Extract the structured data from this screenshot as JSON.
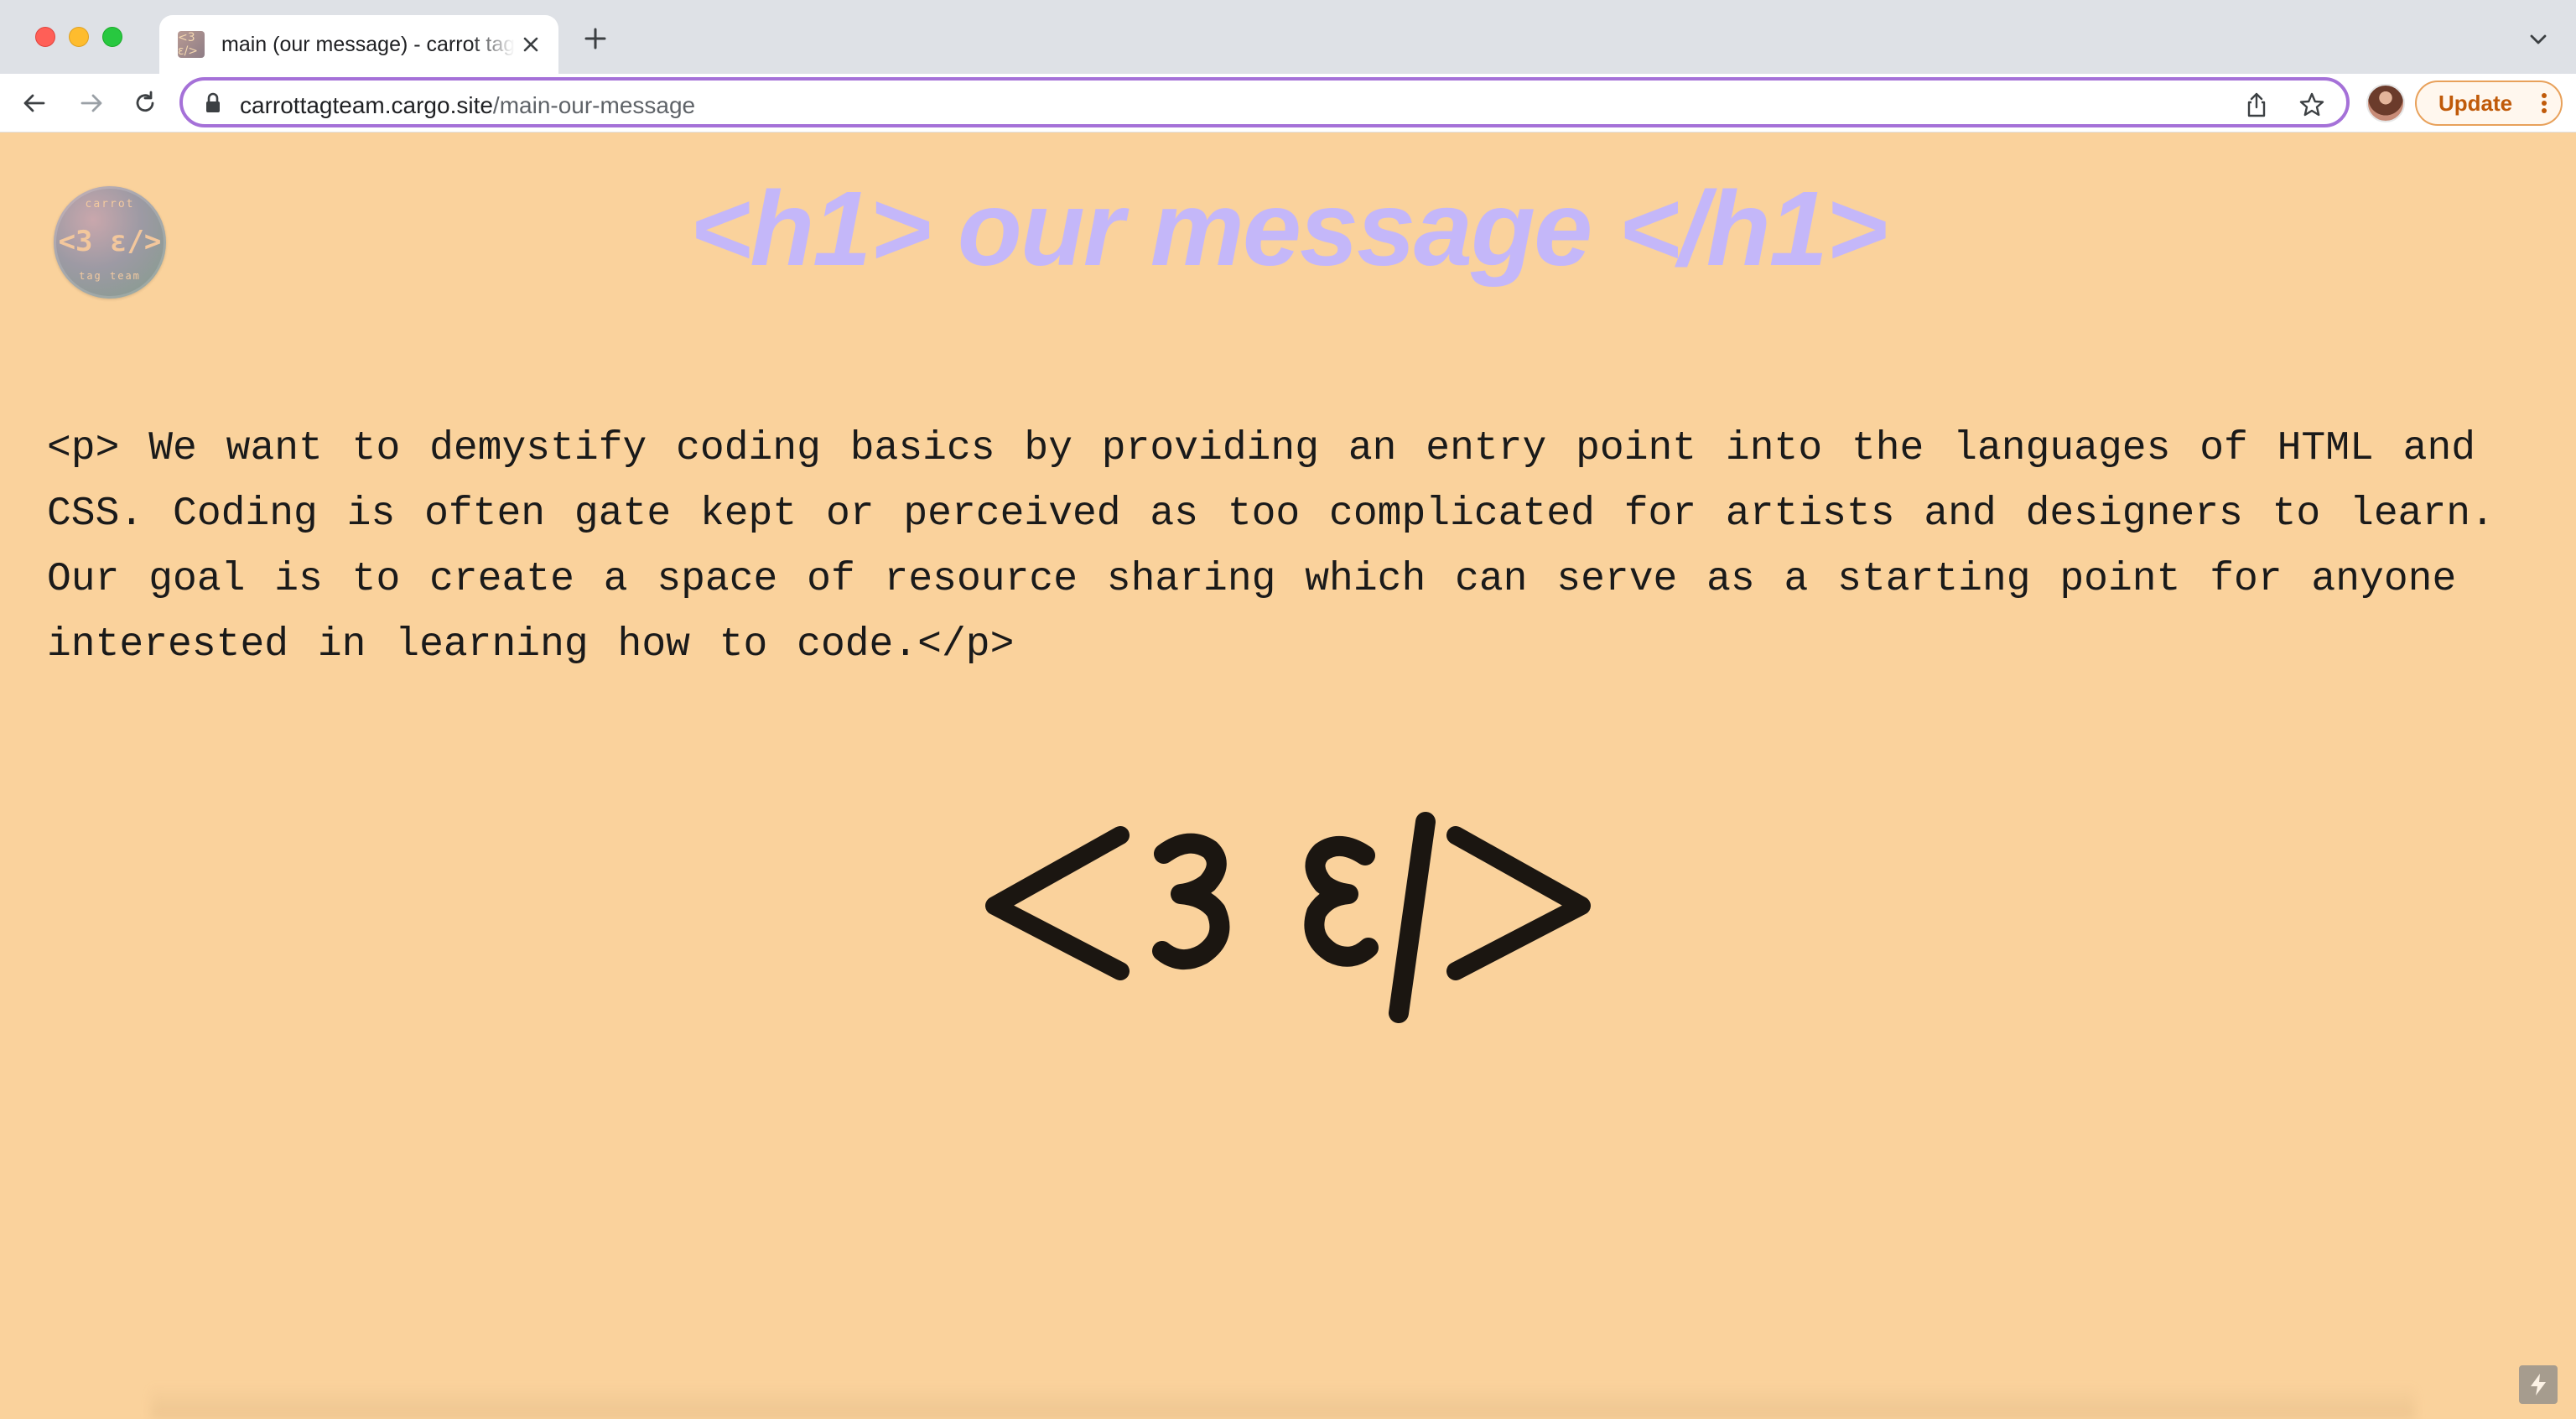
{
  "browser": {
    "tab": {
      "title": "main (our message) - carrot tag team",
      "favicon_text": "<3 ε/>"
    },
    "address_bar": {
      "domain": "carrottagteam.cargo.site",
      "path": "/main-our-message"
    },
    "update_button": {
      "label": "Update"
    },
    "colors": {
      "omnibox_focus": "#a571d8",
      "update_text": "#c05a09"
    }
  },
  "page": {
    "background": "#fad29c",
    "badge": {
      "top_text": "carrot",
      "mid_text": "<3 ε/>",
      "bottom_text": "tag team"
    },
    "heading": "<h1> our message </h1>",
    "heading_color": "#c4b7f9",
    "message": "<p> We want to demystify coding basics by providing an entry point into the languages of HTML and CSS. Coding is often gate kept or perceived as too complicated for artists and designers to learn. Our goal is to create a space of resource sharing which can serve as a starting point for anyone interested in learning how to code.</p>",
    "logo_alt": "<3 ε/>"
  },
  "icons": {
    "back": "arrow-left-icon",
    "forward": "arrow-right-icon",
    "reload": "reload-icon",
    "lock": "lock-icon",
    "share": "share-icon",
    "bookmark": "star-icon",
    "menu": "kebab-menu-icon",
    "bolt": "lightning-icon"
  }
}
